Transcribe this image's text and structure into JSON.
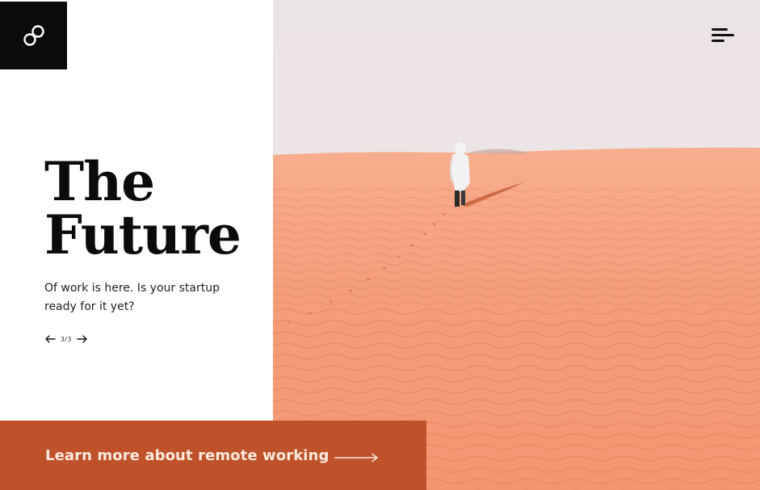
{
  "brand": {
    "logo_icon": "infinity-link-icon",
    "logo_bg": "#0b0b0b"
  },
  "header": {
    "menu_icon": "hamburger-menu-icon"
  },
  "hero": {
    "title_line1": "The",
    "title_line2": "Future",
    "subtitle": "Of work is here. Is your startup ready for it yet?",
    "image": "desert-sand-dunes-person-in-white-suit"
  },
  "slider": {
    "prev_icon": "arrow-left-icon",
    "counter": "3/3",
    "next_icon": "arrow-right-icon"
  },
  "cta": {
    "label": "Learn more about remote working",
    "arrow_icon": "long-arrow-right-icon",
    "color": "#bf522b",
    "text_color": "#fde9dd"
  },
  "colors": {
    "sand": "#f5a07e",
    "sky": "#ece6e6"
  }
}
